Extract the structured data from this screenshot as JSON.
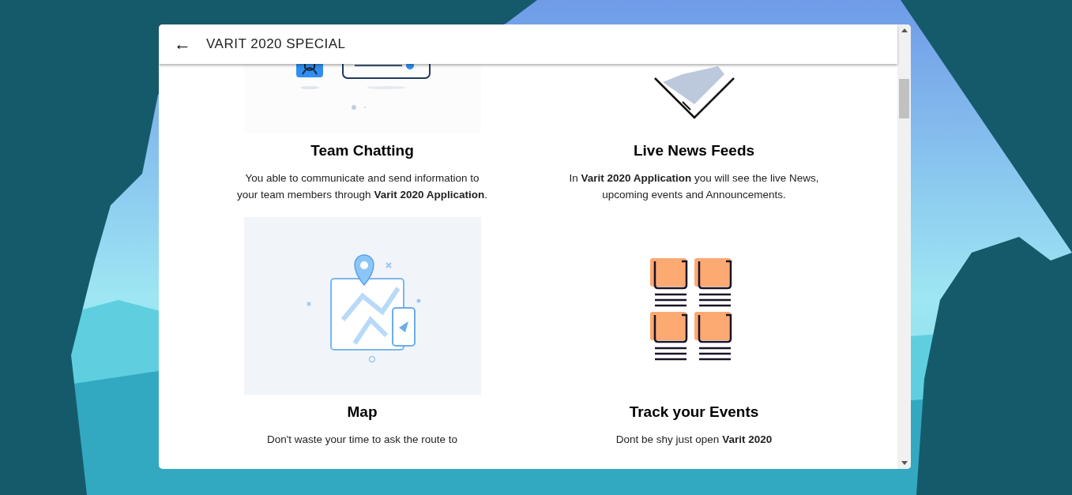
{
  "header": {
    "back_icon": "←",
    "title": "VARIT 2020 SPECIAL"
  },
  "features": [
    {
      "kind": "chat",
      "title": "Team Chatting",
      "description": "You able to communicate and send information to your team members through **Varit 2020 Application**."
    },
    {
      "kind": "news",
      "title": "Live News Feeds",
      "description": "In **Varit 2020 Application** you will see the live News, upcoming events and Announcements."
    },
    {
      "kind": "map",
      "title": "Map",
      "description": "Don't waste your time to ask the route to"
    },
    {
      "kind": "events",
      "title": "Track your Events",
      "description": "Dont be shy just open **Varit 2020**"
    }
  ]
}
